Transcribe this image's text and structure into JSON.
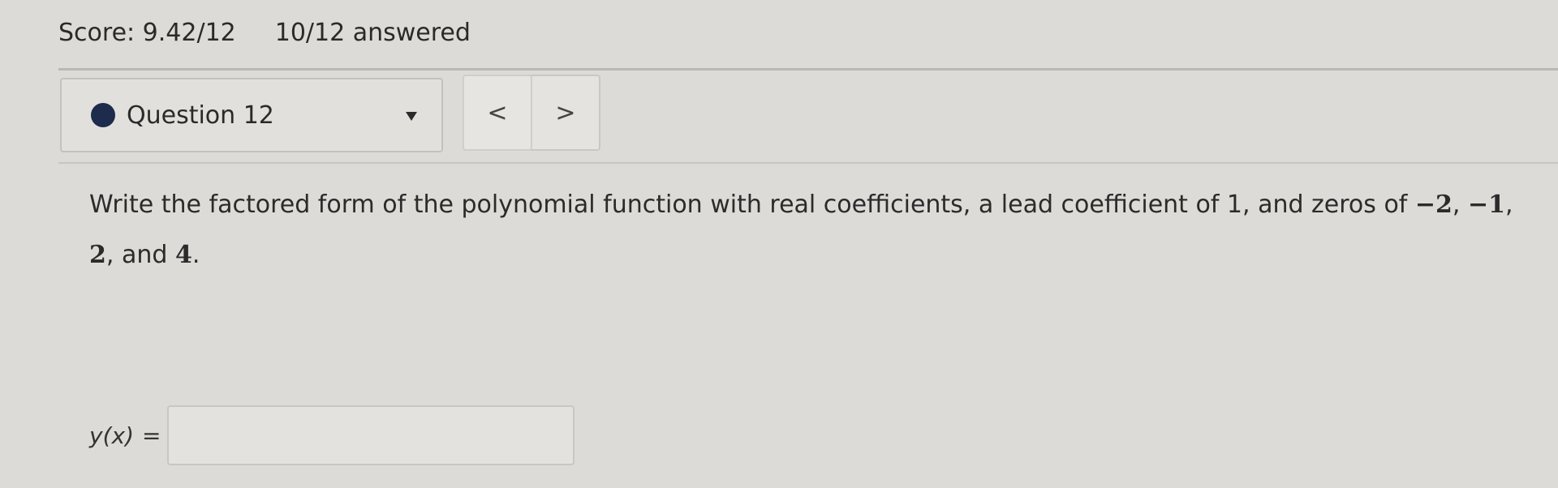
{
  "header": {
    "score": "Score: 9.42/12",
    "answered": "10/12 answered"
  },
  "question_nav": {
    "current": "Question 12",
    "prev_glyph": "<",
    "next_glyph": ">"
  },
  "question": {
    "prompt_text": "Write the factored form of the polynomial function with real coefficients, a lead coefficient of 1, and zeros of ",
    "zero_1": "−2",
    "sep_1": ", ",
    "zero_2": "−1",
    "sep_2": ", ",
    "zero_3": "2",
    "sep_3": ", and ",
    "zero_4": "4",
    "end": "."
  },
  "answer": {
    "lhs": "y(x)",
    "equals": "=",
    "value": ""
  },
  "colors": {
    "status_dot": "#1d2b4c",
    "background": "#dcdbd7"
  }
}
